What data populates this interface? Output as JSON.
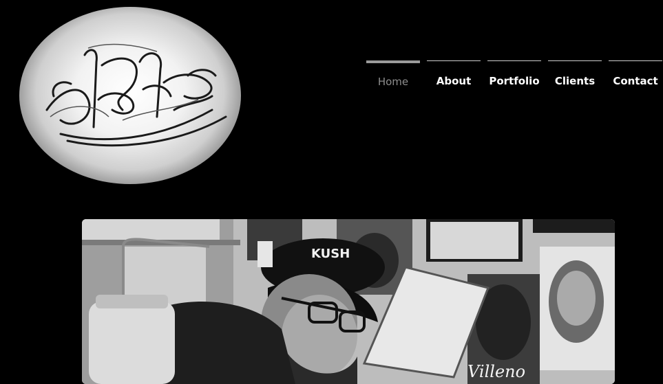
{
  "logo": {
    "icon": "tattoo-studio-logo"
  },
  "nav": {
    "items": [
      {
        "label": "Home",
        "active": true
      },
      {
        "label": "About",
        "active": false
      },
      {
        "label": "Portfolio",
        "active": false
      },
      {
        "label": "Clients",
        "active": false
      },
      {
        "label": "Contact",
        "active": false
      }
    ]
  },
  "hero": {
    "cap_text": "KUSH",
    "poster_text": "Villeno"
  },
  "colors": {
    "background": "#000000",
    "nav_text": "#ffffff",
    "nav_active_text": "#8e8e8e",
    "nav_active_bar": "#9a9a9a"
  }
}
